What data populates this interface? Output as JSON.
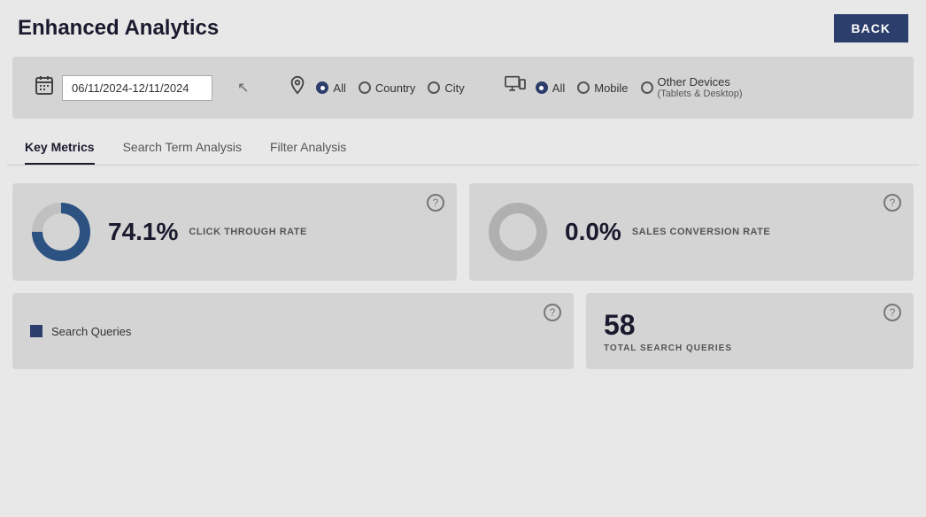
{
  "header": {
    "title": "Enhanced Analytics",
    "back_button_label": "BACK"
  },
  "filters": {
    "date_range_value": "06/11/2024-12/11/2024",
    "location": {
      "options": [
        "All",
        "Country",
        "City"
      ],
      "selected": "All"
    },
    "device": {
      "options": [
        "All",
        "Mobile",
        "Other Devices"
      ],
      "other_devices_sub": "(Tablets & Desktop)",
      "selected": "All"
    }
  },
  "tabs": [
    {
      "label": "Key Metrics",
      "active": true
    },
    {
      "label": "Search Term Analysis",
      "active": false
    },
    {
      "label": "Filter Analysis",
      "active": false
    }
  ],
  "metrics": [
    {
      "value": "74.1%",
      "label": "CLICK THROUGH RATE",
      "chart_filled": 74.1,
      "chart_color": "#2c5282"
    },
    {
      "value": "0.0%",
      "label": "SALES CONVERSION RATE",
      "chart_filled": 0,
      "chart_color": "#b0b0b0"
    }
  ],
  "bottom": {
    "search_queries_label": "Search Queries",
    "total_queries": {
      "count": "58",
      "label": "TOTAL SEARCH QUERIES"
    }
  },
  "icons": {
    "calendar": "📅",
    "pin": "📍",
    "device": "🖥",
    "help": "?",
    "search_legend": "■"
  }
}
